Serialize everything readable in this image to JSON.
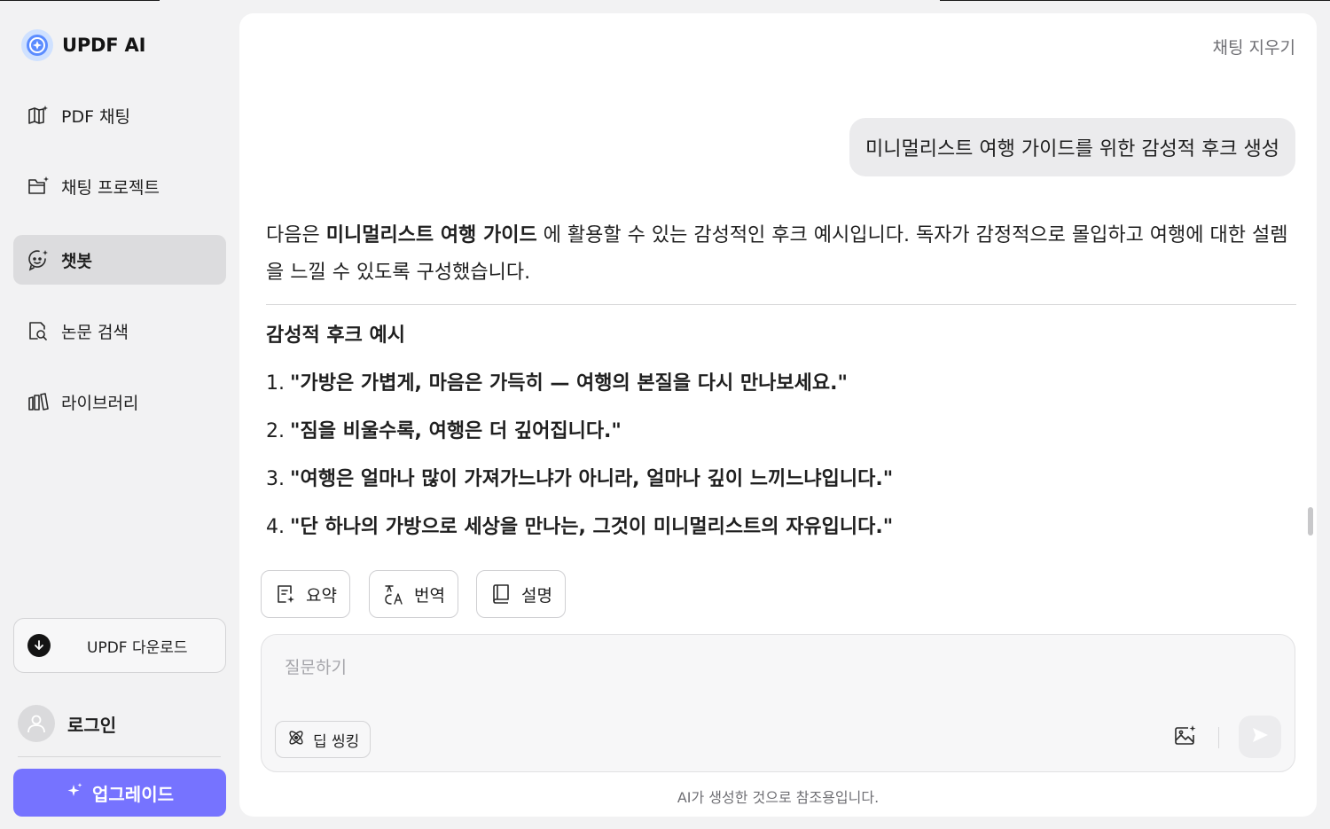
{
  "brand": {
    "name": "UPDF AI"
  },
  "sidebar": {
    "items": [
      {
        "label": "PDF 채팅",
        "icon": "book-sparkle-icon"
      },
      {
        "label": "채팅 프로젝트",
        "icon": "folder-sparkle-icon"
      },
      {
        "label": "챗봇",
        "icon": "chatbot-icon",
        "active": true
      },
      {
        "label": "논문 검색",
        "icon": "document-search-icon"
      },
      {
        "label": "라이브러리",
        "icon": "library-icon"
      }
    ],
    "download_label": "UPDF 다운로드",
    "login_label": "로그인",
    "upgrade_label": "업그레이드"
  },
  "header": {
    "clear_chat": "채팅 지우기"
  },
  "chat": {
    "user_message": "미니멀리스트 여행 가이드를 위한 감성적 후크 생성",
    "answer_pre": "다음은 ",
    "answer_bold": "미니멀리스트 여행 가이드",
    "answer_post": " 에 활용할 수 있는 감성적인 후크 예시입니다. 독자가 감정적으로 몰입하고 여행에 대한 설렘을 느낄 수 있도록 구성했습니다.",
    "section_title": "감성적 후크 예시",
    "hooks": [
      {
        "num": "1.",
        "text": "\"가방은 가볍게, 마음은 가득히 — 여행의 본질을 다시 만나보세요.\""
      },
      {
        "num": "2.",
        "text": "\"짐을 비울수록, 여행은 더 깊어집니다.\""
      },
      {
        "num": "3.",
        "text": "\"여행은 얼마나 많이 가져가느냐가 아니라, 얼마나 깊이 느끼느냐입니다.\""
      },
      {
        "num": "4.",
        "text": "\"단 하나의 가방으로 세상을 만나는, 그것이 미니멀리스트의 자유입니다.\""
      }
    ]
  },
  "actions": {
    "summary": "요약",
    "translate": "번역",
    "explain": "설명"
  },
  "composer": {
    "placeholder": "질문하기",
    "deep_thinking": "딥 씽킹"
  },
  "footer": {
    "disclaimer": "AI가 생성한 것으로 참조용입니다."
  },
  "colors": {
    "accent": "#7673ff",
    "active_nav": "#dcdcde",
    "background": "#f2f2f3"
  }
}
